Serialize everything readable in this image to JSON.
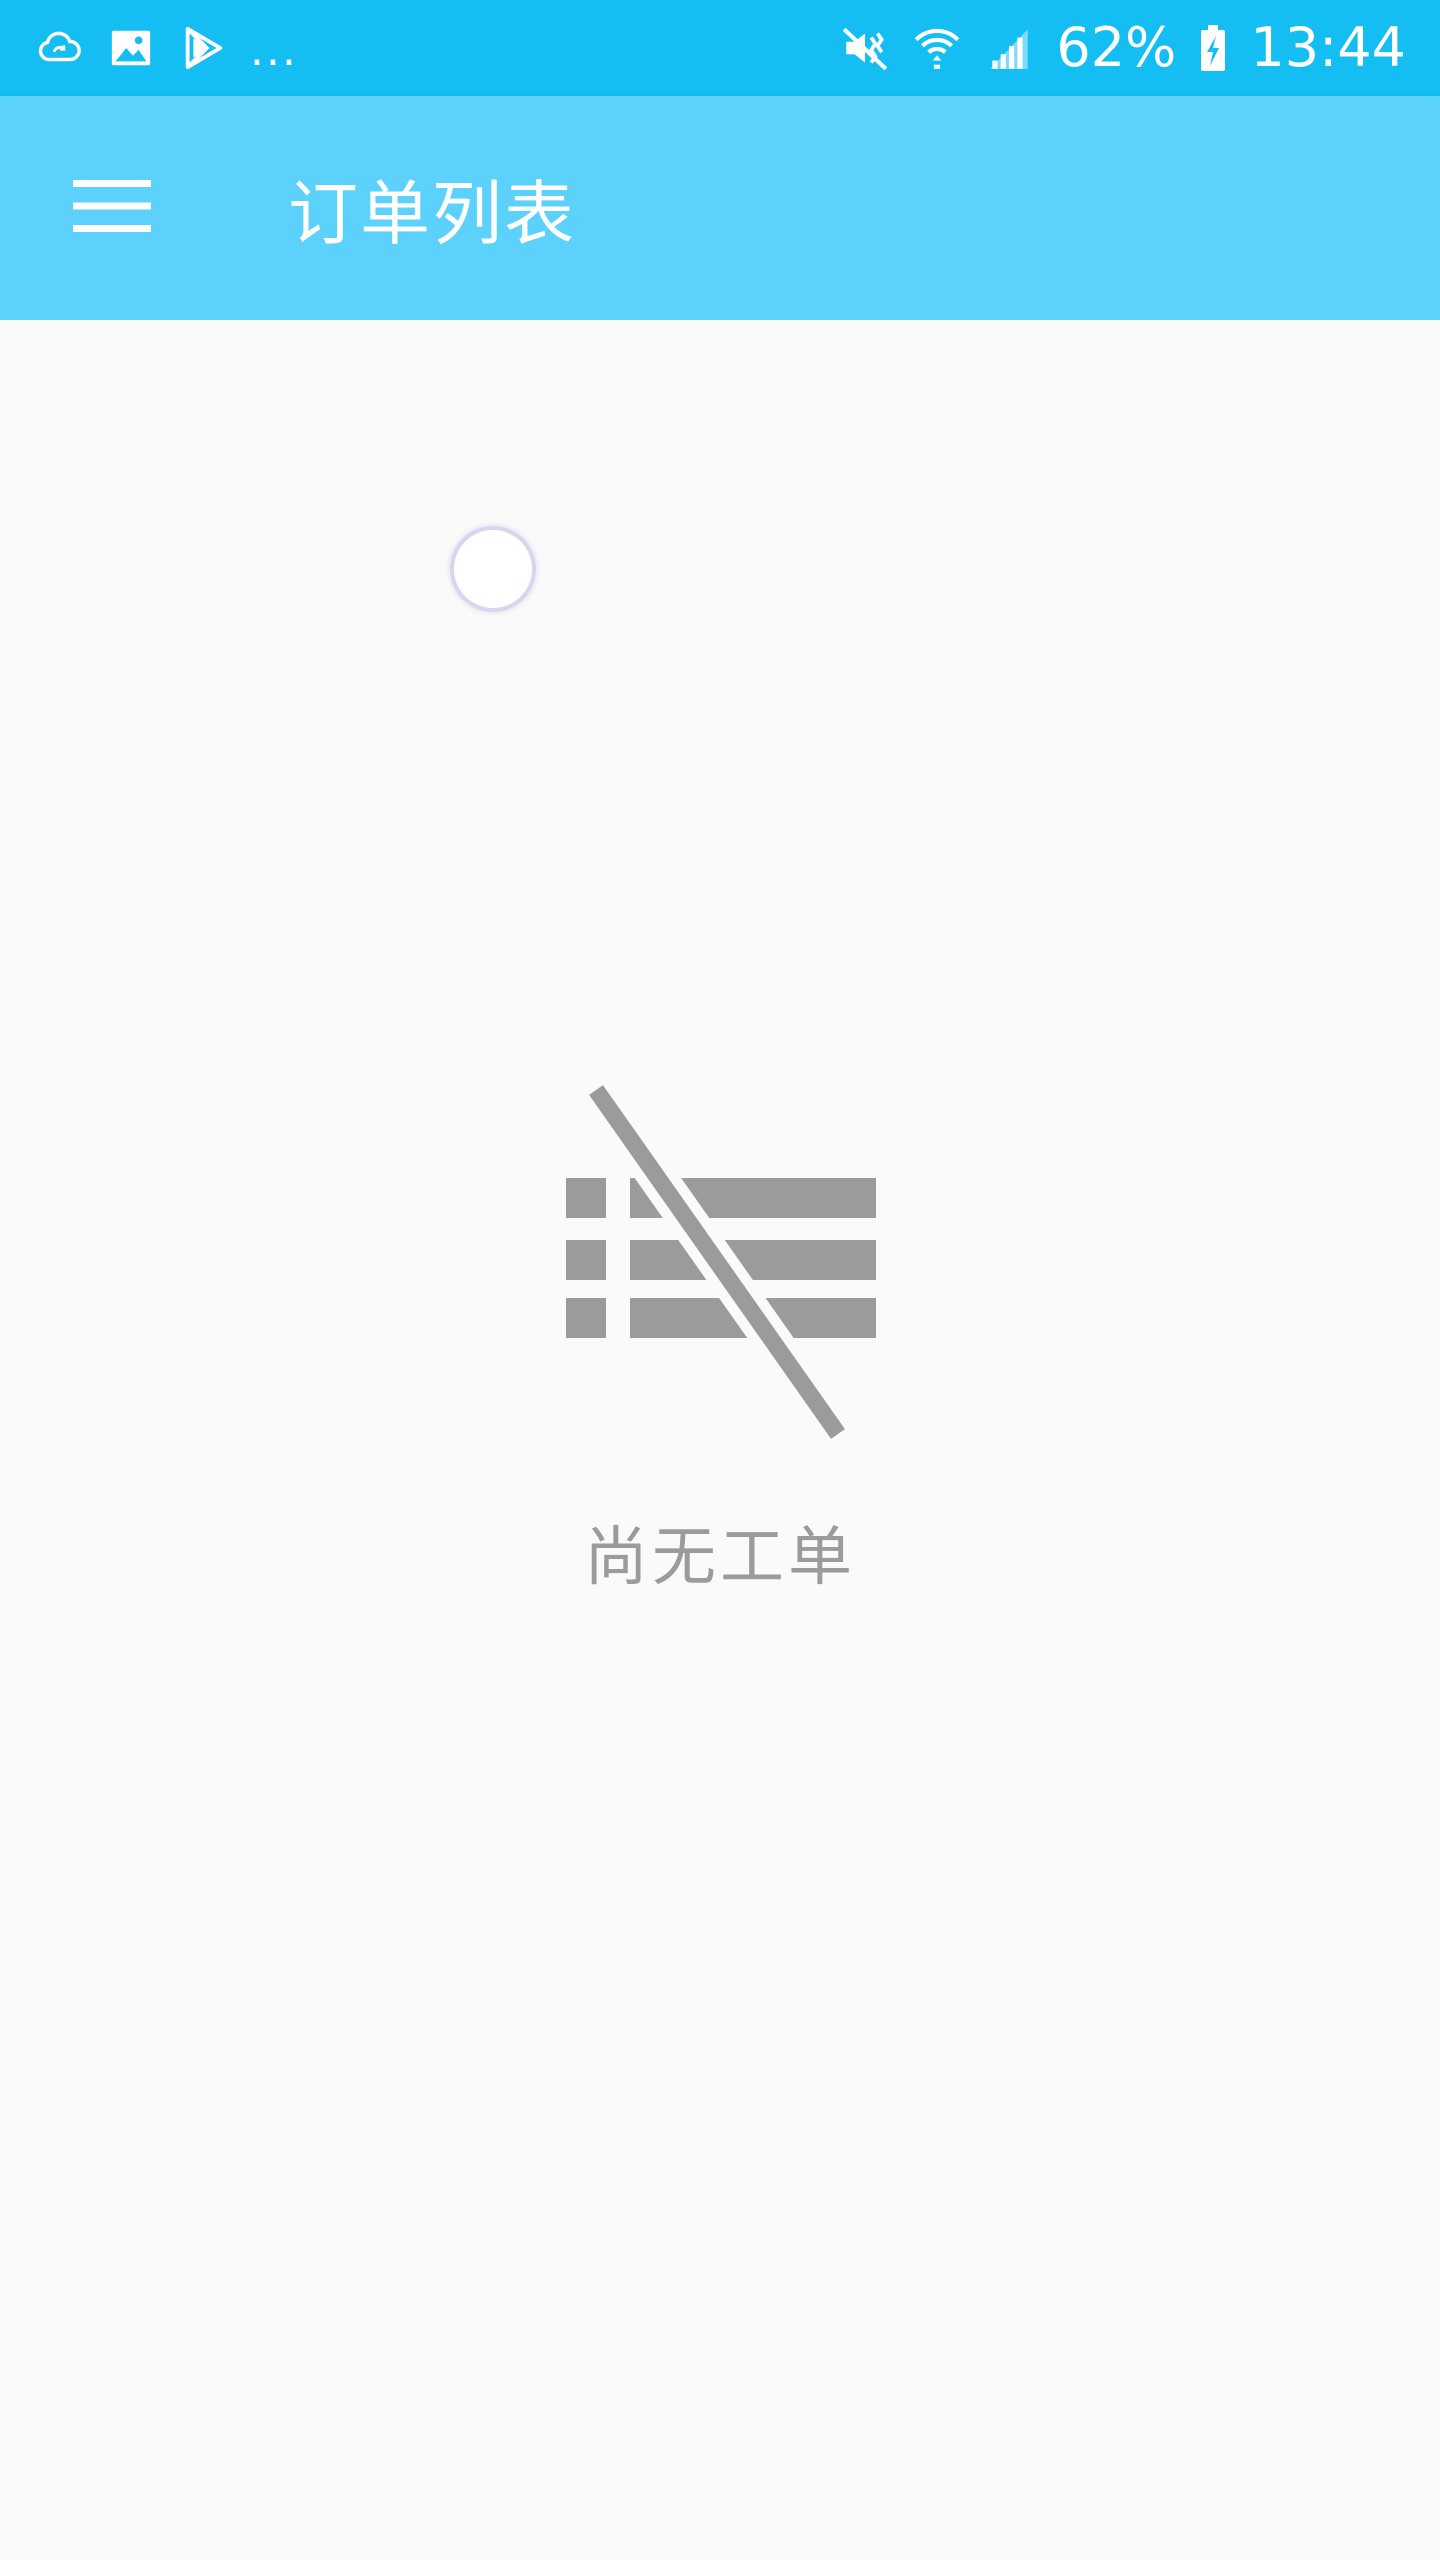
{
  "status_bar": {
    "left_icons": [
      "cloud-sync-icon",
      "image-icon",
      "play-store-icon"
    ],
    "more_indicator": "...",
    "right_icons": [
      "mute-icon",
      "wifi-icon",
      "signal-icon"
    ],
    "battery_percent": "62%",
    "battery_icon": "battery-charging-icon",
    "time": "13:44"
  },
  "app_bar": {
    "menu_icon": "hamburger-menu-icon",
    "title": "订单列表",
    "color": "#5bd1fc"
  },
  "content": {
    "loading_indicator": "loading-spinner",
    "empty_state": {
      "icon": "no-list-icon",
      "message": "尚无工单",
      "color": "#9b9b9b"
    }
  },
  "colors": {
    "status_bar": "#14bdf2",
    "background": "#fafafa"
  }
}
